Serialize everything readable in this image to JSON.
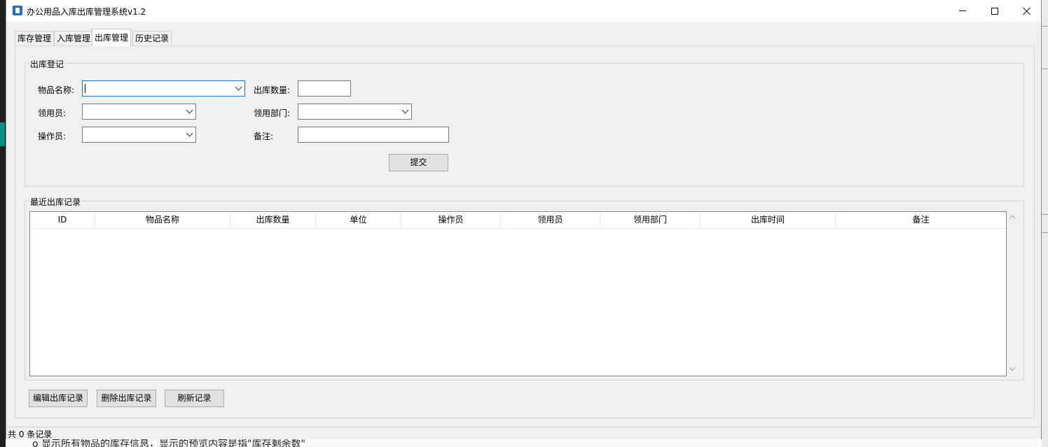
{
  "window": {
    "title": "办公用品入库出库管理系统v1.2"
  },
  "tabs": [
    {
      "label": "库存管理",
      "active": false
    },
    {
      "label": "入库管理",
      "active": false
    },
    {
      "label": "出库管理",
      "active": true
    },
    {
      "label": "历史记录",
      "active": false
    }
  ],
  "form": {
    "group_title": "出库登记",
    "item_name_label": "物品名称:",
    "item_name_value": "",
    "quantity_label": "出库数量:",
    "quantity_value": "",
    "recipient_label": "领用员:",
    "recipient_value": "",
    "department_label": "领用部门:",
    "department_value": "",
    "operator_label": "操作员:",
    "operator_value": "",
    "remark_label": "备注:",
    "remark_value": "",
    "submit_label": "提交"
  },
  "records": {
    "group_title": "最近出库记录",
    "columns": [
      "ID",
      "物品名称",
      "出库数量",
      "单位",
      "操作员",
      "领用员",
      "领用部门",
      "出库时间",
      "备注"
    ],
    "rows": []
  },
  "actions": {
    "edit_label": "编辑出库记录",
    "delete_label": "删除出库记录",
    "refresh_label": "刷新记录"
  },
  "status": {
    "text": "共 0 条记录"
  },
  "background": {
    "behind_text": "o 显示所有物品的库存信息，显示的预览内容是指\"库存剩余数\""
  },
  "colors": {
    "focus_border": "#0078d7",
    "window_bg": "#f0f0f0",
    "accent_teal": "#0f8f7f"
  }
}
